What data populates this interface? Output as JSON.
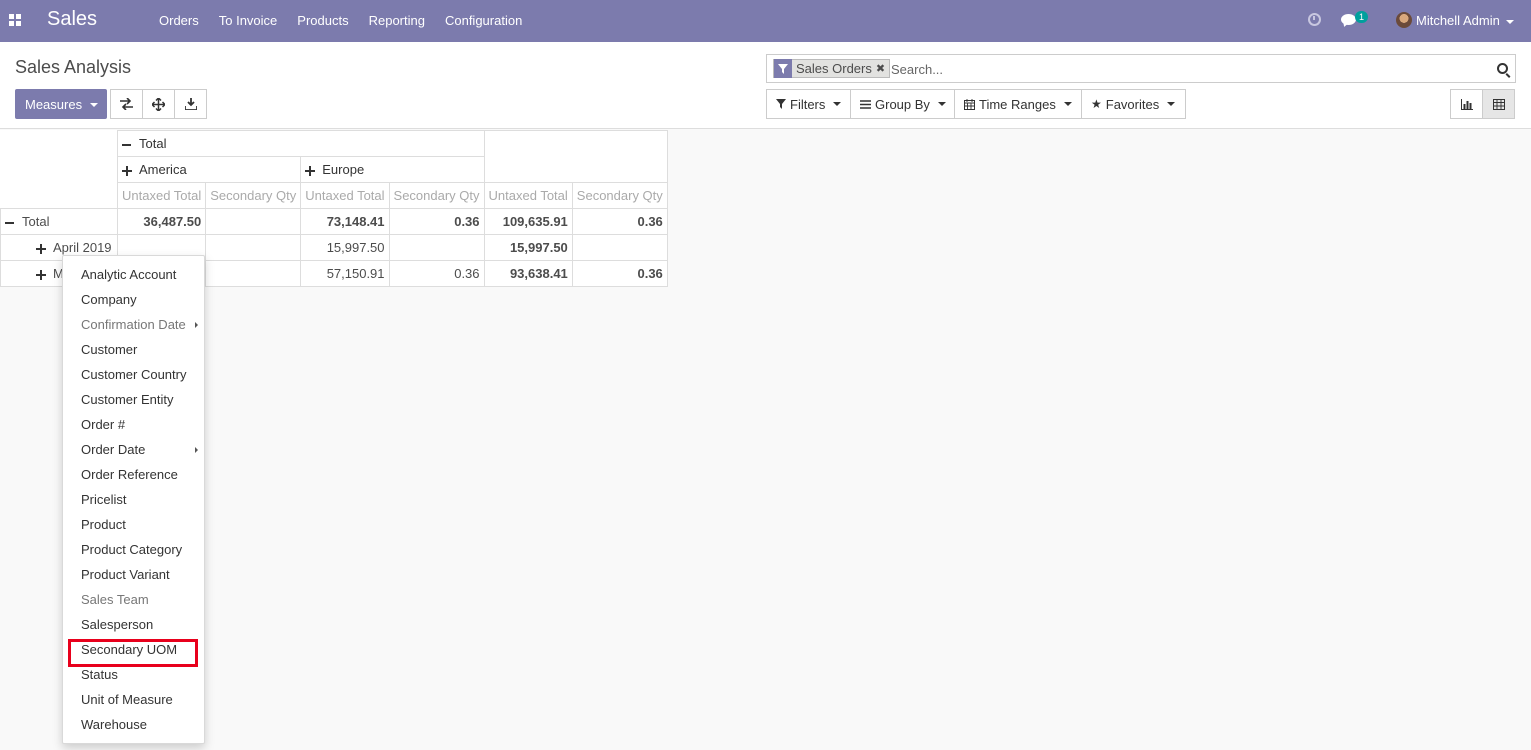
{
  "navbar": {
    "brand": "Sales",
    "menu": [
      "Orders",
      "To Invoice",
      "Products",
      "Reporting",
      "Configuration"
    ],
    "chat_count": "1",
    "user_name": "Mitchell Admin"
  },
  "control": {
    "title": "Sales Analysis",
    "measures_label": "Measures",
    "search": {
      "facet": "Sales Orders",
      "placeholder": "Search..."
    },
    "filters_label": "Filters",
    "groupby_label": "Group By",
    "timeranges_label": "Time Ranges",
    "favorites_label": "Favorites"
  },
  "pivot": {
    "col_total": "Total",
    "col_groups": [
      "America",
      "Europe"
    ],
    "measures": [
      "Untaxed Total",
      "Secondary Qty"
    ],
    "rows": [
      {
        "label": "Total",
        "cells": [
          "36,487.50",
          "",
          "73,148.41",
          "0.36",
          "109,635.91",
          "0.36"
        ]
      },
      {
        "label": "April 2019",
        "cells": [
          "",
          "",
          "15,997.50",
          "",
          "15,997.50",
          ""
        ]
      },
      {
        "label": "M",
        "cells": [
          "",
          "",
          "57,150.91",
          "0.36",
          "93,638.41",
          "0.36"
        ]
      }
    ]
  },
  "groupby_menu": {
    "items": [
      "Analytic Account",
      "Company",
      "Confirmation Date",
      "Customer",
      "Customer Country",
      "Customer Entity",
      "Order #",
      "Order Date",
      "Order Reference",
      "Pricelist",
      "Product",
      "Product Category",
      "Product Variant",
      "Sales Team",
      "Salesperson",
      "Secondary UOM",
      "Status",
      "Unit of Measure",
      "Warehouse"
    ],
    "highlighted": "Secondary UOM"
  },
  "colors": {
    "navbar": "#7c7bad",
    "highlight": "#e8001c"
  }
}
